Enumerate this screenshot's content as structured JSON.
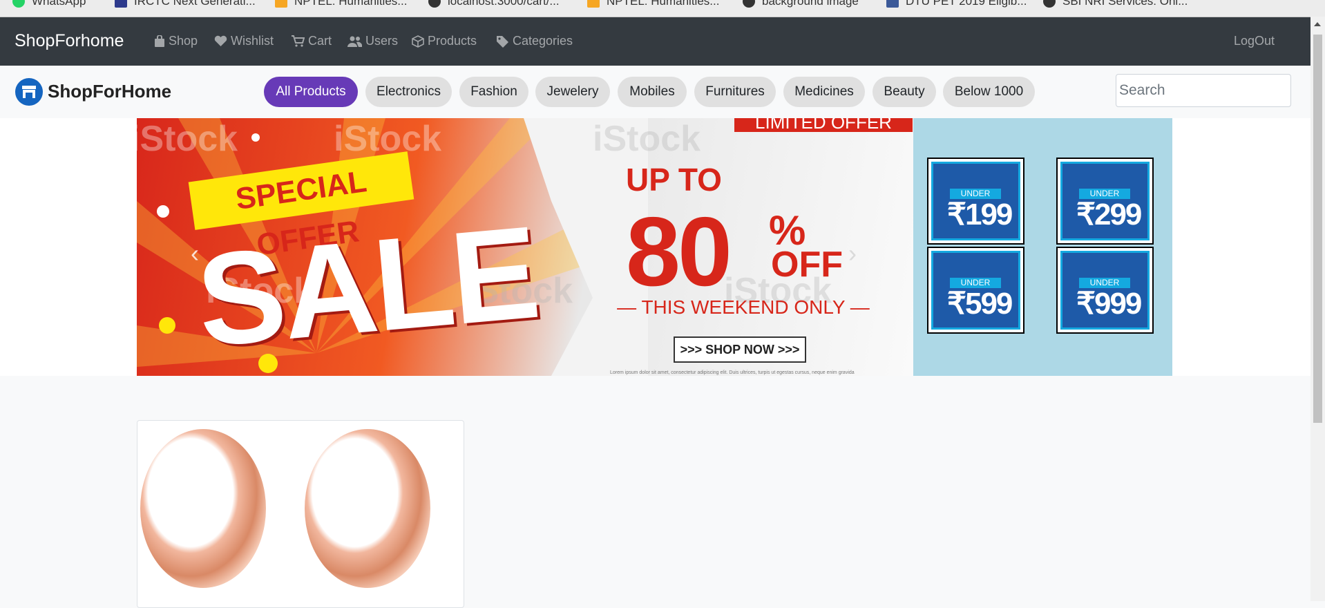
{
  "bookmarks": [
    "WhatsApp",
    "IRCTC Next Generati...",
    "NPTEL: Humanities...",
    "localhost:3000/cart/...",
    "NPTEL: Humanities...",
    "background image",
    "DTU PET 2019 Eligib...",
    "SBI NRI Services: Onl..."
  ],
  "navbar": {
    "brand": "ShopForhome",
    "items": [
      {
        "label": "Shop",
        "icon": "bag-icon"
      },
      {
        "label": "Wishlist",
        "icon": "heart-icon"
      },
      {
        "label": "Cart",
        "icon": "cart-icon"
      },
      {
        "label": "Users",
        "icon": "users-icon"
      },
      {
        "label": "Products",
        "icon": "box-icon"
      },
      {
        "label": "Categories",
        "icon": "tag-icon"
      }
    ],
    "logout": "LogOut"
  },
  "catbar": {
    "logo_text": "ShopForHome",
    "categories": [
      "All Products",
      "Electronics",
      "Fashion",
      "Jewelery",
      "Mobiles",
      "Furnitures",
      "Medicines",
      "Beauty",
      "Below 1000"
    ],
    "active_index": 0,
    "search_placeholder": "Search"
  },
  "banner": {
    "limited": "LIMITED OFFER",
    "special": "SPECIAL OFFER",
    "sale": "SALE",
    "upto": "UP TO",
    "discount": "80",
    "percent": "%",
    "off": "OFF",
    "weekend": "— THIS WEEKEND ONLY —",
    "shop_now": ">>> SHOP NOW >>>",
    "fine_print": "Lorem ipsum dolor sit amet, consectetur adipiscing elit. Duis ultrices, turpis ut egestas cursus, neque enim gravida",
    "watermark": "iStock"
  },
  "price_tiles": [
    {
      "under": "UNDER",
      "price": "₹199"
    },
    {
      "under": "UNDER",
      "price": "₹299"
    },
    {
      "under": "UNDER",
      "price": "₹599"
    },
    {
      "under": "UNDER",
      "price": "₹999"
    }
  ],
  "colors": {
    "navbar": "#343a40",
    "active_pill": "#673ab7",
    "pill": "#e0e0e0",
    "side_panel": "#add8e6",
    "sale_red": "#d7261a"
  }
}
